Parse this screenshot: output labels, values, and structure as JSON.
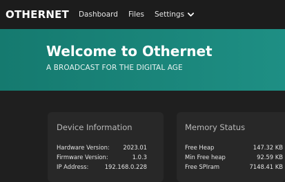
{
  "nav": {
    "brand": "OTHERNET",
    "items": [
      {
        "label": "Dashboard"
      },
      {
        "label": "Files"
      },
      {
        "label": "Settings",
        "icon": "chevron-down-icon"
      }
    ]
  },
  "hero": {
    "title": "Welcome to Othernet",
    "subtitle": "A BROADCAST FOR THE DIGITAL AGE"
  },
  "device_card": {
    "title": "Device Information",
    "rows": [
      {
        "key": "Hardware Version:",
        "value": "2023.01"
      },
      {
        "key": "Firmware Version:",
        "value": "1.0.3"
      },
      {
        "key": "IP Address:",
        "value": "192.168.0.228"
      }
    ]
  },
  "memory_card": {
    "title": "Memory Status",
    "rows": [
      {
        "key": "Free Heap",
        "value": "147.32 KB"
      },
      {
        "key": "Min Free heap",
        "value": "92.59 KB"
      },
      {
        "key": "Free SPIram",
        "value": "7148.41 KB"
      }
    ]
  },
  "colors": {
    "hero": "#1a857a",
    "background": "#1f1f1f",
    "card": "#282828",
    "navbar": "#1c1c1c"
  }
}
